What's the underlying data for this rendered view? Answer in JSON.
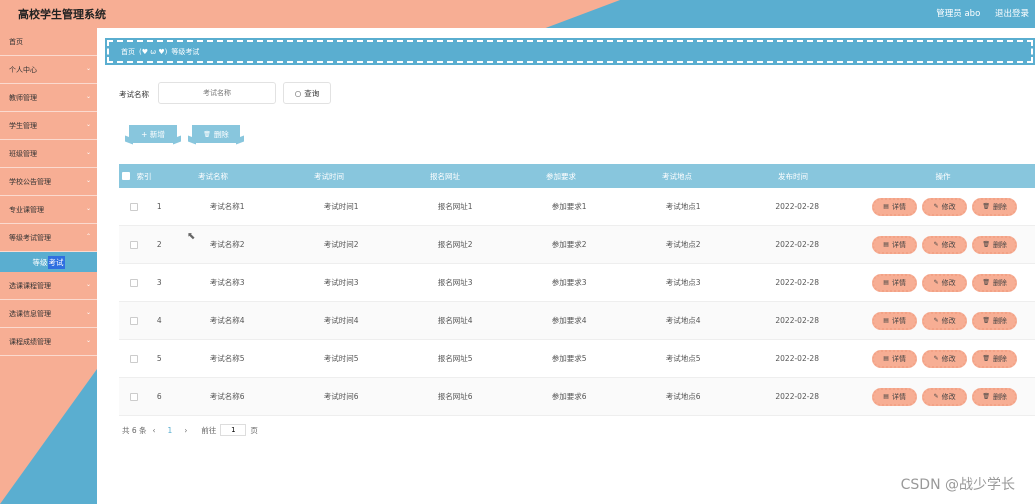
{
  "header": {
    "title": "高校学生管理系统",
    "user": "管理员 abo",
    "logout": "退出登录"
  },
  "sidebar": {
    "items": [
      {
        "label": "首页",
        "chevron": ""
      },
      {
        "label": "个人中心",
        "chevron": "⌄"
      },
      {
        "label": "教师管理",
        "chevron": "⌄"
      },
      {
        "label": "学生管理",
        "chevron": "⌄"
      },
      {
        "label": "班级管理",
        "chevron": "⌄"
      },
      {
        "label": "学校公告管理",
        "chevron": "⌄"
      },
      {
        "label": "专业课管理",
        "chevron": "⌄"
      },
      {
        "label": "等级考试管理",
        "chevron": "⌃"
      }
    ],
    "sub_item_prefix": "等级",
    "sub_item_highlight": "考试",
    "items_after": [
      {
        "label": "选课课程管理",
        "chevron": "⌄"
      },
      {
        "label": "选课信息管理",
        "chevron": "⌄"
      },
      {
        "label": "课程成绩管理",
        "chevron": "⌄"
      }
    ]
  },
  "breadcrumb": {
    "home": "首页",
    "emoji": "(♥ ω ♥)",
    "current": "等级考试"
  },
  "search": {
    "label": "考试名称",
    "placeholder": "考试名称",
    "button": "查询",
    "search_icon": "○"
  },
  "actions": {
    "add": "+ 新增",
    "delete": "删除",
    "delete_icon": "🗑"
  },
  "table": {
    "headers": [
      "索引",
      "考试名称",
      "考试时间",
      "报名网址",
      "参加要求",
      "考试地点",
      "发布时间",
      "操作"
    ],
    "rows": [
      [
        "1",
        "考试名称1",
        "考试时间1",
        "报名网址1",
        "参加要求1",
        "考试地点1",
        "2022-02-28"
      ],
      [
        "2",
        "考试名称2",
        "考试时间2",
        "报名网址2",
        "参加要求2",
        "考试地点2",
        "2022-02-28"
      ],
      [
        "3",
        "考试名称3",
        "考试时间3",
        "报名网址3",
        "参加要求3",
        "考试地点3",
        "2022-02-28"
      ],
      [
        "4",
        "考试名称4",
        "考试时间4",
        "报名网址4",
        "参加要求4",
        "考试地点4",
        "2022-02-28"
      ],
      [
        "5",
        "考试名称5",
        "考试时间5",
        "报名网址5",
        "参加要求5",
        "考试地点5",
        "2022-02-28"
      ],
      [
        "6",
        "考试名称6",
        "考试时间6",
        "报名网址6",
        "参加要求6",
        "考试地点6",
        "2022-02-28"
      ]
    ],
    "op_buttons": [
      {
        "icon": "▤",
        "label": "详情",
        "name": "detail"
      },
      {
        "icon": "✎",
        "label": "修改",
        "name": "edit"
      },
      {
        "icon": "🗑",
        "label": "删除",
        "name": "delete"
      }
    ]
  },
  "pagination": {
    "total": "共 6 条",
    "prev": "‹",
    "page": "1",
    "next": "›",
    "goto": "前往",
    "goto_value": "1",
    "page_unit": "页"
  },
  "watermark": "CSDN @战少学长",
  "colors": {
    "peach": "#f7ae94",
    "blue": "#5aaed0",
    "light_blue": "#88c6dd"
  }
}
